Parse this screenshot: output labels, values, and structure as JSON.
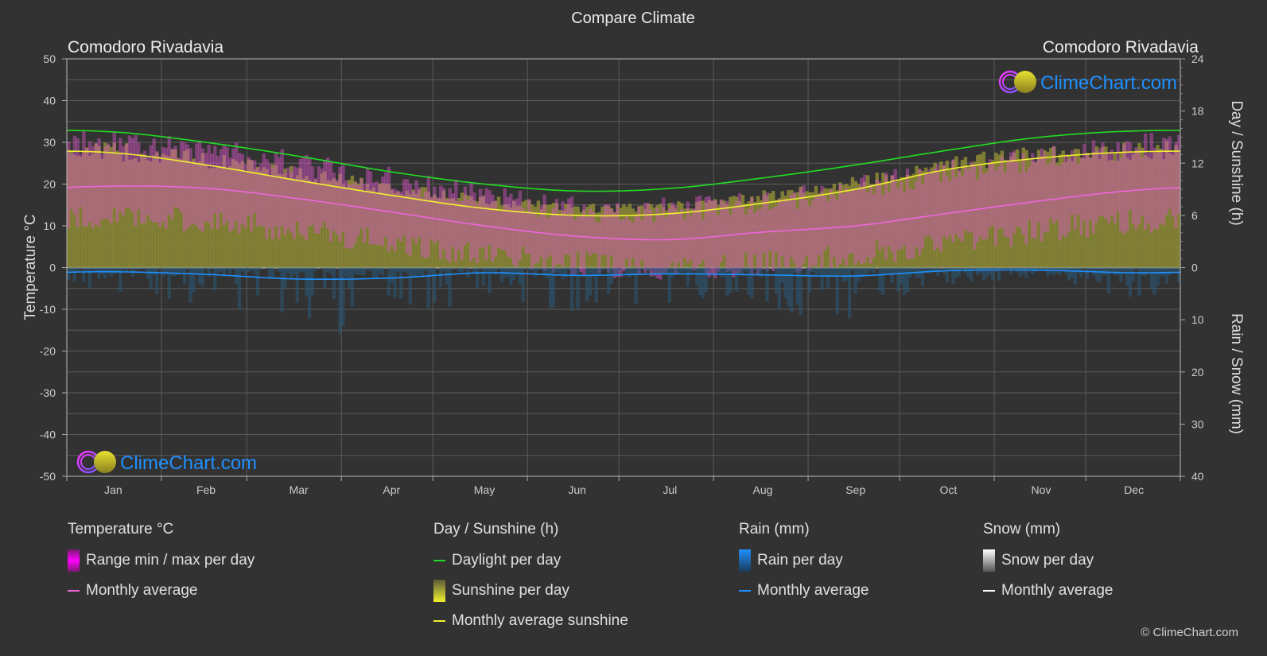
{
  "title": "Compare Climate",
  "location_left": "Comodoro Rivadavia",
  "location_right": "Comodoro Rivadavia",
  "watermark": "ClimeChart.com",
  "copyright": "© ClimeChart.com",
  "colors": {
    "background": "#323232",
    "daylight": "#22dd22",
    "sunshine_avg": "#f0f030",
    "sunshine_fill": "#8c8a35",
    "temp_avg": "#ee66dd",
    "temp_range": "#d957c8",
    "rain": "#1e90ff",
    "snow": "#ffffff",
    "grid": "#5a5a5a",
    "text": "#e0e0e0"
  },
  "chart_data": {
    "type": "line",
    "title": "Compare Climate",
    "categories": [
      "Jan",
      "Feb",
      "Mar",
      "Apr",
      "May",
      "Jun",
      "Jul",
      "Aug",
      "Sep",
      "Oct",
      "Nov",
      "Dec"
    ],
    "left_axis": {
      "label": "Temperature °C",
      "ylim": [
        -50,
        50
      ],
      "ticks": [
        "50",
        "40",
        "30",
        "20",
        "10",
        "0",
        "-10",
        "-20",
        "-30",
        "-40",
        "-50"
      ]
    },
    "right_axis_top": {
      "label": "Day / Sunshine (h)",
      "ylim": [
        0,
        24
      ],
      "ticks": [
        "24",
        "18",
        "12",
        "6",
        "0"
      ]
    },
    "right_axis_bottom": {
      "label": "Rain / Snow (mm)",
      "ylim": [
        0,
        40
      ],
      "ticks": [
        "0",
        "10",
        "20",
        "30",
        "40"
      ]
    },
    "series": [
      {
        "name": "Daylight per day",
        "axis": "sunshine_h",
        "values": [
          15.6,
          14.4,
          12.8,
          11.0,
          9.6,
          8.8,
          9.1,
          10.3,
          11.8,
          13.5,
          15.0,
          15.7
        ]
      },
      {
        "name": "Monthly average sunshine",
        "axis": "sunshine_h",
        "values": [
          13.2,
          11.8,
          10.0,
          8.3,
          6.8,
          6.0,
          6.2,
          7.4,
          9.0,
          11.3,
          12.6,
          13.3
        ]
      },
      {
        "name": "Sunshine per day (max envelope)",
        "axis": "sunshine_h",
        "values": [
          14.4,
          13.3,
          11.6,
          9.8,
          8.4,
          7.4,
          7.6,
          8.9,
          10.6,
          12.8,
          14.0,
          14.5
        ]
      },
      {
        "name": "Temperature monthly average",
        "axis": "temperature_c",
        "values": [
          19.5,
          19.0,
          16.5,
          13.3,
          10.0,
          7.5,
          6.7,
          8.5,
          10.0,
          13.0,
          16.0,
          18.5
        ]
      },
      {
        "name": "Temperature max per day (approx)",
        "axis": "temperature_c",
        "values": [
          30,
          28,
          25,
          21,
          17,
          14,
          14,
          16,
          19,
          23,
          26,
          29
        ]
      },
      {
        "name": "Temperature min per day (approx)",
        "axis": "temperature_c",
        "values": [
          12,
          11,
          9,
          6,
          3,
          1,
          0,
          1,
          3,
          6,
          9,
          11
        ]
      },
      {
        "name": "Rain monthly average",
        "axis": "precip_mm",
        "values": [
          0.8,
          1.3,
          2.2,
          2.0,
          1.0,
          1.5,
          1.2,
          1.4,
          1.6,
          0.6,
          0.5,
          1.0
        ]
      },
      {
        "name": "Snow monthly average",
        "axis": "precip_mm",
        "values": [
          0,
          0,
          0,
          0,
          0,
          0,
          0,
          0,
          0,
          0,
          0,
          0
        ]
      }
    ],
    "grid": true,
    "legend_placement": "bottom"
  },
  "legend": {
    "groups": [
      {
        "title": "Temperature °C",
        "items": [
          {
            "label": "Range min / max per day",
            "type": "bar",
            "icon": "temperature-range-swatch"
          },
          {
            "label": "Monthly average",
            "type": "line",
            "icon": "temperature-average-line"
          }
        ]
      },
      {
        "title": "Day / Sunshine (h)",
        "items": [
          {
            "label": "Daylight per day",
            "type": "line",
            "icon": "daylight-line"
          },
          {
            "label": "Sunshine per day",
            "type": "bar",
            "icon": "sunshine-swatch"
          },
          {
            "label": "Monthly average sunshine",
            "type": "line",
            "icon": "sunshine-average-line"
          }
        ]
      },
      {
        "title": "Rain (mm)",
        "items": [
          {
            "label": "Rain per day",
            "type": "bar",
            "icon": "rain-swatch"
          },
          {
            "label": "Monthly average",
            "type": "line",
            "icon": "rain-average-line"
          }
        ]
      },
      {
        "title": "Snow (mm)",
        "items": [
          {
            "label": "Snow per day",
            "type": "bar",
            "icon": "snow-swatch"
          },
          {
            "label": "Monthly average",
            "type": "line",
            "icon": "snow-average-line"
          }
        ]
      }
    ]
  }
}
